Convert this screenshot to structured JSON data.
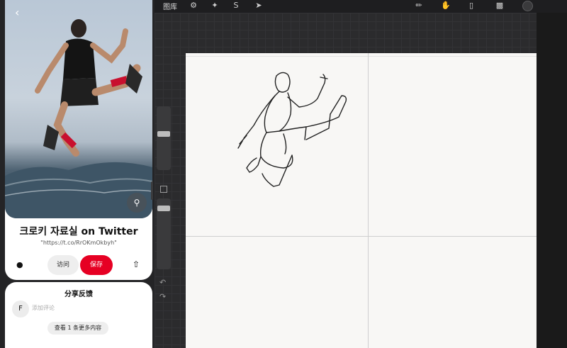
{
  "procreate": {
    "gallery_label": "图库",
    "tools": [
      "wrench-icon",
      "magic-wand-icon",
      "selection-icon",
      "transform-icon",
      "brush-icon",
      "smudge-icon",
      "eraser-icon",
      "layers-icon"
    ],
    "color": "#3a3a3c"
  },
  "pin": {
    "title": "크로키 자료실 on Twitter",
    "url": "\"https://t.co/RrOKmOkbyh\"",
    "visit_label": "访问",
    "save_label": "保存",
    "save_color": "#e60023"
  },
  "feedback": {
    "title": "分享反馈",
    "avatar_initial": "F",
    "comment_placeholder": "添加评论",
    "more_label": "查看 1 条更多内容"
  }
}
